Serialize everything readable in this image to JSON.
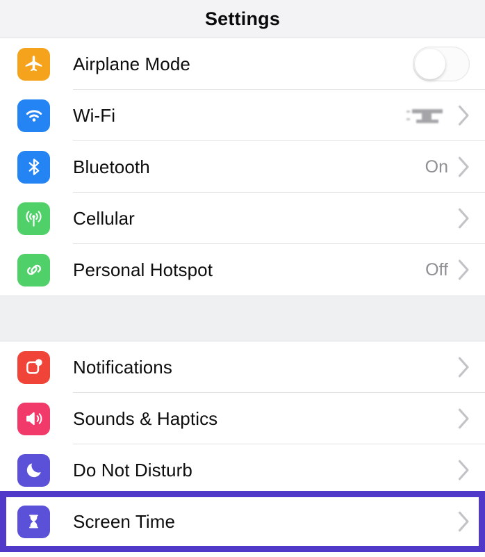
{
  "header": {
    "title": "Settings"
  },
  "colors": {
    "highlight": "#5038c8",
    "page_bg": "#ffffff",
    "group_gap_bg": "#eff0f2",
    "nav_bg": "#f3f3f5",
    "value_text": "#8e8e93",
    "chevron": "#c3c3c7",
    "airplane": "#f5a21d",
    "wifi": "#2484f4",
    "bluetooth": "#2484f4",
    "cellular": "#4fd069",
    "hotspot": "#4fd069",
    "notifications": "#f04438",
    "sounds": "#f1396a",
    "do_not_disturb": "#5b51d8",
    "screen_time": "#5b51d8"
  },
  "sections": [
    {
      "rows": [
        {
          "label": "Airplane Mode",
          "icon": "airplane-icon",
          "accessory": "toggle",
          "toggle_on": false,
          "value": ""
        },
        {
          "label": "Wi-Fi",
          "icon": "wifi-icon",
          "accessory": "chevron",
          "value": "",
          "value_redacted": true
        },
        {
          "label": "Bluetooth",
          "icon": "bluetooth-icon",
          "accessory": "chevron",
          "value": "On"
        },
        {
          "label": "Cellular",
          "icon": "cellular-icon",
          "accessory": "chevron",
          "value": ""
        },
        {
          "label": "Personal Hotspot",
          "icon": "personal-hotspot-icon",
          "accessory": "chevron",
          "value": "Off"
        }
      ]
    },
    {
      "rows": [
        {
          "label": "Notifications",
          "icon": "notifications-icon",
          "accessory": "chevron",
          "value": ""
        },
        {
          "label": "Sounds & Haptics",
          "icon": "sounds-haptics-icon",
          "accessory": "chevron",
          "value": ""
        },
        {
          "label": "Do Not Disturb",
          "icon": "do-not-disturb-icon",
          "accessory": "chevron",
          "value": ""
        },
        {
          "label": "Screen Time",
          "icon": "screen-time-icon",
          "accessory": "chevron",
          "value": "",
          "highlighted": true
        }
      ]
    }
  ]
}
